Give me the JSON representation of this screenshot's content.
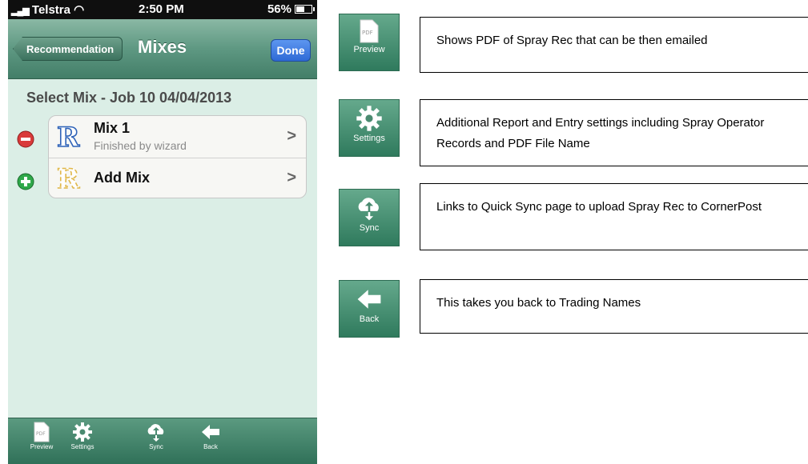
{
  "status_bar": {
    "carrier": "Telstra",
    "time": "2:50 PM",
    "battery": "56%"
  },
  "nav": {
    "back_label": "Recommendation",
    "title": "Mixes",
    "done_label": "Done"
  },
  "section_title": "Select Mix - Job 10 04/04/2013",
  "list": [
    {
      "title": "Mix 1",
      "subtitle": "Finished by wizard",
      "action": "remove"
    },
    {
      "title": "Add Mix",
      "subtitle": "",
      "action": "add"
    }
  ],
  "tabbar": [
    {
      "label": "Preview",
      "icon": "pdf-icon"
    },
    {
      "label": "Settings",
      "icon": "gear-icon"
    },
    {
      "label": "Sync",
      "icon": "cloud-sync-icon"
    },
    {
      "label": "Back",
      "icon": "back-arrow-icon"
    }
  ],
  "legend": [
    {
      "icon_label": "Preview",
      "icon_text": "PDF",
      "description": "Shows PDF of Spray Rec that can be then emailed"
    },
    {
      "icon_label": "Settings",
      "description": "Additional Report and Entry settings including Spray Operator Records and PDF File Name"
    },
    {
      "icon_label": "Sync",
      "description": "Links to Quick Sync page to upload Spray Rec to CornerPost"
    },
    {
      "icon_label": "Back",
      "description": "This takes you back to Trading Names"
    }
  ],
  "colors": {
    "header_green": "#5e9882",
    "background_mint": "#dbeee6",
    "done_blue": "#2e6ad6",
    "remove_red": "#d93a3a",
    "add_green": "#2fa84a"
  }
}
